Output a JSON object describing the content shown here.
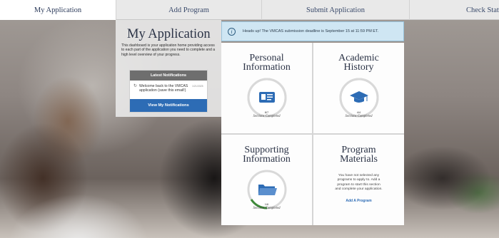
{
  "nav": {
    "tabs": [
      {
        "label": "My Application",
        "active": true
      },
      {
        "label": "Add Program",
        "active": false
      },
      {
        "label": "Submit Application",
        "active": false
      },
      {
        "label": "Check Status",
        "active": false
      }
    ]
  },
  "intro": {
    "title": "My Application",
    "description": "This dashboard is your application home providing access to each part of the application you need to complete and a high level overview of your progress."
  },
  "notifications": {
    "header": "Latest Notifications",
    "items": [
      {
        "text": "Welcome back to the VMCAS application (save this email!)",
        "date": "1/21/2025"
      }
    ],
    "button_label": "View My Notifications"
  },
  "alert": {
    "icon": "info-icon",
    "text": "Heads up! The VMCAS submission deadline is September 15 at 11:59 PM ET."
  },
  "cards": {
    "personal": {
      "title_line1": "Personal",
      "title_line2": "Information",
      "count": "8/7",
      "progress": 1.0,
      "subtitle": "Sections Completed",
      "icon": "id-card-icon"
    },
    "academic": {
      "title_line1": "Academic",
      "title_line2": "History",
      "count": "4/4",
      "progress": 1.0,
      "subtitle": "Sections Completed",
      "icon": "graduation-cap-icon"
    },
    "supporting": {
      "title_line1": "Supporting",
      "title_line2": "Information",
      "count": "1/6",
      "progress": 0.16,
      "subtitle": "Sections Completed",
      "icon": "folder-icon"
    },
    "program": {
      "title_line1": "Program",
      "title_line2": "Materials",
      "text": "You have not selected any programs to apply to. Add a program to start this section and complete your application.",
      "link_label": "Add A Program"
    }
  },
  "colors": {
    "accent_blue": "#2d6cb5",
    "ring_track": "#d9d9d9",
    "ring_progress": "#3f8a3a"
  }
}
